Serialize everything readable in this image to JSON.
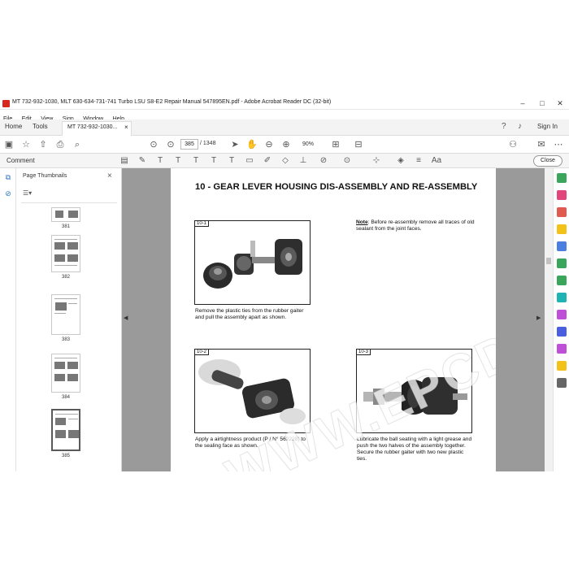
{
  "window": {
    "title": "MT 732-932-1030, MLT 630-634-731-741 Turbo LSU S8-E2 Repair Manual 547895EN.pdf - Adobe Acrobat Reader DC (32-bit)",
    "minimize": "–",
    "maximize": "□",
    "close": "✕"
  },
  "menu": [
    "File",
    "Edit",
    "View",
    "Sign",
    "Window",
    "Help"
  ],
  "tabs": {
    "home": "Home",
    "tools": "Tools",
    "document": "MT 732-932-1030...",
    "document_close": "×",
    "sign_in": "Sign In"
  },
  "toolbar": {
    "current_page": "385",
    "total_pages": "/ 1348",
    "zoom": "90%"
  },
  "comment_bar": {
    "label": "Comment",
    "close_label": "Close"
  },
  "thumbnails": {
    "title": "Page Thumbnails",
    "close": "×",
    "pages": [
      "381",
      "382",
      "383",
      "384",
      "385"
    ],
    "selected_page": "385"
  },
  "document": {
    "heading": "10 - GEAR LEVER HOUSING DIS-ASSEMBLY AND RE-ASSEMBLY",
    "note_label": "Note",
    "note_text": ": Before re-assembly remove all traces of old sealant from the joint faces.",
    "figures": [
      {
        "label": "10-1",
        "caption": "Remove the plastic ties from the rubber gaiter and pull the assembly apart as shown."
      },
      {
        "label": "10-2",
        "caption": "Apply a airtightness product (P / N° 562228) to the sealing face as shown."
      },
      {
        "label": "10-3",
        "caption": "Lubricate the ball seating with a light grease and push the two halves of the assembly together. Secure the rubber gaiter with two new plastic ties."
      }
    ],
    "watermark": "WWW.EPCDEPO.COM"
  }
}
